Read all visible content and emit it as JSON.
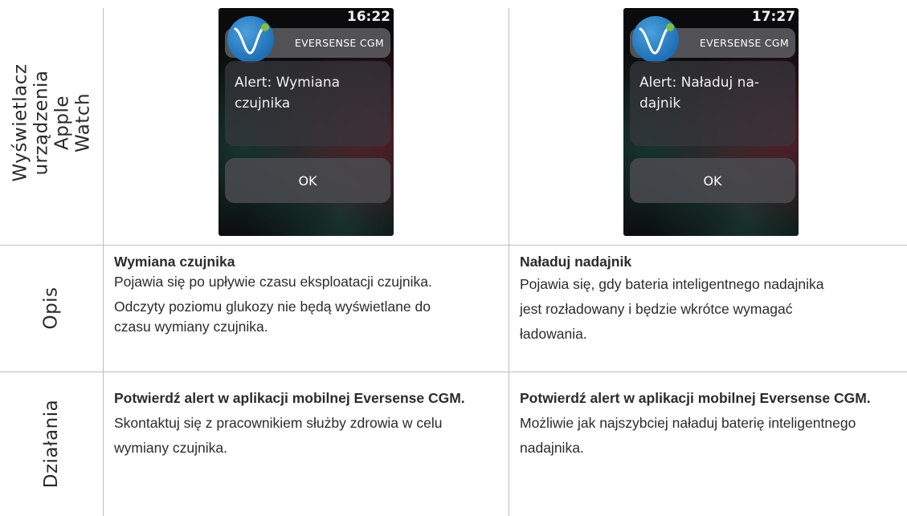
{
  "rows": {
    "display_label": "Wyświetlacz\nurządzenia\nApple Watch",
    "description_label": "Opis",
    "actions_label": "Działania"
  },
  "watch_left": {
    "time": "16:22",
    "app_name": "EVERSENSE CGM",
    "message": "Alert: Wymiana\nczujnika",
    "ok_label": "OK"
  },
  "watch_right": {
    "time": "17:27",
    "app_name": "EVERSENSE CGM",
    "message": "Alert: Naładuj na-\ndajnik",
    "ok_label": "OK"
  },
  "description_left": {
    "title": "Wymiana czujnika",
    "line1": "Pojawia się po upływie czasu eksploatacji czujnika.",
    "line2": "Odczyty poziomu glukozy nie będą wyświetlane do czasu wymiany czujnika."
  },
  "description_right": {
    "title": "Naładuj nadajnik",
    "line1": "Pojawia się, gdy bateria inteligentnego nadajnika jest rozładowany i będzie wkrótce wymagać ładowania."
  },
  "actions_left": {
    "bold": "Potwierdź alert w aplikacji mobilnej Eversense CGM.",
    "text": " Skontaktuj się z pracownikiem służby zdrowia w celu wymiany czujnika."
  },
  "actions_right": {
    "bold": "Potwierdź alert w aplikacji mobilnej Eversense CGM.",
    "text": " Możliwie jak najszybciej naładuj baterię inteligentnego nadajnika."
  },
  "colors": {
    "grid": "#bdbdbd",
    "logo_blue": "#1f6fb5",
    "logo_dot_green": "#7cc043"
  }
}
